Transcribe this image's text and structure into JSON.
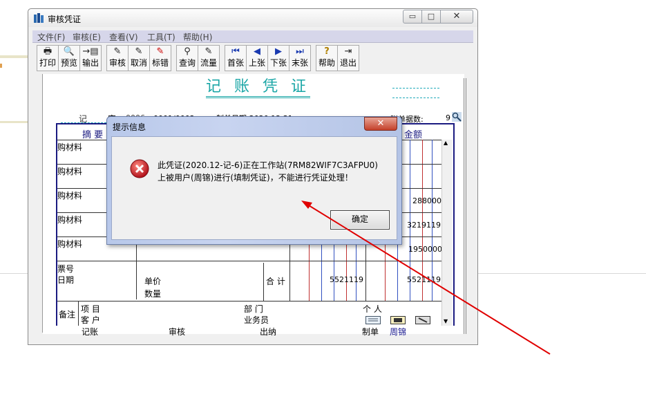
{
  "window": {
    "title": "审核凭证",
    "min_glyph": "▭",
    "max_glyph": "□",
    "close_glyph": "✕"
  },
  "menu": [
    "文件(F)",
    "审核(E)",
    "查看(V)",
    "工具(T)",
    "帮助(H)"
  ],
  "toolbar": [
    {
      "label": "打印",
      "icon": "printer-icon",
      "glyph": "🖶"
    },
    {
      "label": "预览",
      "icon": "preview-icon",
      "glyph": "🔍"
    },
    {
      "label": "输出",
      "icon": "export-icon",
      "glyph": "→▤"
    },
    {
      "label": "审核",
      "icon": "audit-icon",
      "glyph": "✎"
    },
    {
      "label": "取消",
      "icon": "cancel-icon",
      "glyph": "✎"
    },
    {
      "label": "标错",
      "icon": "mark-error-icon",
      "glyph": "✎"
    },
    {
      "label": "查询",
      "icon": "binoculars-icon",
      "glyph": "⚲"
    },
    {
      "label": "流量",
      "icon": "flow-icon",
      "glyph": "✎"
    },
    {
      "label": "首张",
      "icon": "first-icon",
      "glyph": "⏮"
    },
    {
      "label": "上张",
      "icon": "prev-icon",
      "glyph": "◀"
    },
    {
      "label": "下张",
      "icon": "next-icon",
      "glyph": "▶"
    },
    {
      "label": "末张",
      "icon": "last-icon",
      "glyph": "⏭"
    },
    {
      "label": "帮助",
      "icon": "help-icon",
      "glyph": "?"
    },
    {
      "label": "退出",
      "icon": "exit-icon",
      "glyph": "⇥"
    }
  ],
  "voucher": {
    "title": "记 账 凭 证",
    "type_label": "记",
    "zi_label": "字",
    "number": "0006",
    "dash": "-",
    "page": "0001/0002",
    "date_label": "制单日期:2020.12.31",
    "attach_label": "附单据数:",
    "attach_count": "9",
    "col_summary": "摘 要",
    "col_amount": "金额",
    "rows": [
      {
        "summary": "购材料",
        "amount": ""
      },
      {
        "summary": "购材料",
        "amount": ""
      },
      {
        "summary": "购材料",
        "amount": "288000"
      },
      {
        "summary": "购材料",
        "amount": "3219119"
      },
      {
        "summary": "购材料",
        "amount": "1950000"
      }
    ],
    "ticket_no": "票号",
    "ticket_date": "日期",
    "unit_price": "单价",
    "quantity": "数量",
    "total_label": "合 计",
    "total_debit": "5521119",
    "total_credit": "5521119",
    "remark": "备注",
    "project": "项 目",
    "customer": "客 户",
    "dept": "部 门",
    "salesman": "业务员",
    "person": "个 人",
    "footer_bookkeep": "记账",
    "footer_audit": "审核",
    "footer_cashier": "出纳",
    "footer_maker": "制单",
    "footer_maker_name": "周锦"
  },
  "dialog": {
    "title": "提示信息",
    "close_glyph": "✕",
    "message_line1": "此凭证(2020.12-记-6)正在工作站(7RM82WIF7C3AFPU0)",
    "message_line2": "上被用户(周锦)进行(填制凭证)，不能进行凭证处理！",
    "ok_label": "确定"
  },
  "colors": {
    "accent_teal": "#1aa6a6",
    "table_border": "#1a1a80",
    "arrow_red": "#e00000",
    "error_red": "#c8101a"
  }
}
